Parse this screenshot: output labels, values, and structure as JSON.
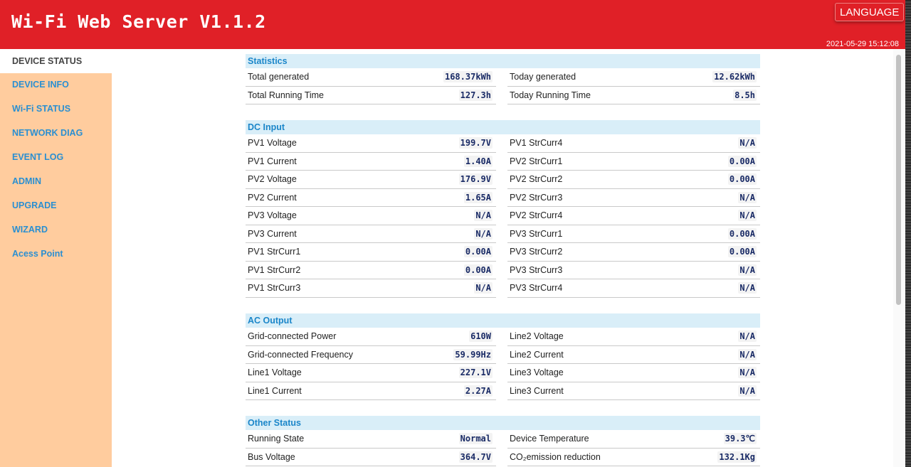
{
  "header": {
    "title": "Wi-Fi Web Server V1.1.2",
    "language_label": "LANGUAGE",
    "datetime": "2021-05-29 15:12:08"
  },
  "sidebar": {
    "items": [
      {
        "label": "DEVICE STATUS",
        "active": true
      },
      {
        "label": "DEVICE INFO"
      },
      {
        "label": "Wi-Fi STATUS"
      },
      {
        "label": "NETWORK DIAG"
      },
      {
        "label": "EVENT LOG"
      },
      {
        "label": "ADMIN"
      },
      {
        "label": "UPGRADE"
      },
      {
        "label": "WIZARD"
      },
      {
        "label": "Acess Point"
      }
    ]
  },
  "sections": {
    "statistics": {
      "title": "Statistics",
      "left": [
        {
          "label": "Total generated",
          "value": "168.37kWh"
        },
        {
          "label": "Total Running Time",
          "value": "127.3h"
        }
      ],
      "right": [
        {
          "label": "Today generated",
          "value": "12.62kWh"
        },
        {
          "label": "Today Running Time",
          "value": "8.5h"
        }
      ]
    },
    "dc_input": {
      "title": "DC Input",
      "left": [
        {
          "label": "PV1 Voltage",
          "value": "199.7V"
        },
        {
          "label": "PV1 Current",
          "value": "1.40A"
        },
        {
          "label": "PV2 Voltage",
          "value": "176.9V"
        },
        {
          "label": "PV2 Current",
          "value": "1.65A"
        },
        {
          "label": "PV3 Voltage",
          "value": "N/A"
        },
        {
          "label": "PV3 Current",
          "value": "N/A"
        },
        {
          "label": "PV1 StrCurr1",
          "value": "0.00A"
        },
        {
          "label": "PV1 StrCurr2",
          "value": "0.00A"
        },
        {
          "label": "PV1 StrCurr3",
          "value": "N/A"
        }
      ],
      "right": [
        {
          "label": "PV1 StrCurr4",
          "value": "N/A"
        },
        {
          "label": "PV2 StrCurr1",
          "value": "0.00A"
        },
        {
          "label": "PV2 StrCurr2",
          "value": "0.00A"
        },
        {
          "label": "PV2 StrCurr3",
          "value": "N/A"
        },
        {
          "label": "PV2 StrCurr4",
          "value": "N/A"
        },
        {
          "label": "PV3 StrCurr1",
          "value": "0.00A"
        },
        {
          "label": "PV3 StrCurr2",
          "value": "0.00A"
        },
        {
          "label": "PV3 StrCurr3",
          "value": "N/A"
        },
        {
          "label": "PV3 StrCurr4",
          "value": "N/A"
        }
      ]
    },
    "ac_output": {
      "title": "AC Output",
      "left": [
        {
          "label": "Grid-connected Power",
          "value": "610W"
        },
        {
          "label": "Grid-connected Frequency",
          "value": "59.99Hz"
        },
        {
          "label": "Line1 Voltage",
          "value": "227.1V"
        },
        {
          "label": "Line1 Current",
          "value": "2.27A"
        }
      ],
      "right": [
        {
          "label": "Line2 Voltage",
          "value": "N/A"
        },
        {
          "label": "Line2 Current",
          "value": "N/A"
        },
        {
          "label": "Line3 Voltage",
          "value": "N/A"
        },
        {
          "label": "Line3 Current",
          "value": "N/A"
        }
      ]
    },
    "other_status": {
      "title": "Other Status",
      "left": [
        {
          "label": "Running State",
          "value": "Normal"
        },
        {
          "label": "Bus Voltage",
          "value": "364.7V"
        }
      ],
      "right": [
        {
          "label": "Device Temperature",
          "value": "39.3℃"
        },
        {
          "label": "CO₂emission reduction",
          "value": "132.1Kg"
        }
      ]
    }
  },
  "colors": {
    "header_bg": "#e02027",
    "sidebar_bg": "#ffcc9e",
    "nav_link": "#2a8fd1",
    "section_header_bg": "#d9eef8",
    "section_header_text": "#1b86c9",
    "value_text": "#1a2b66"
  }
}
